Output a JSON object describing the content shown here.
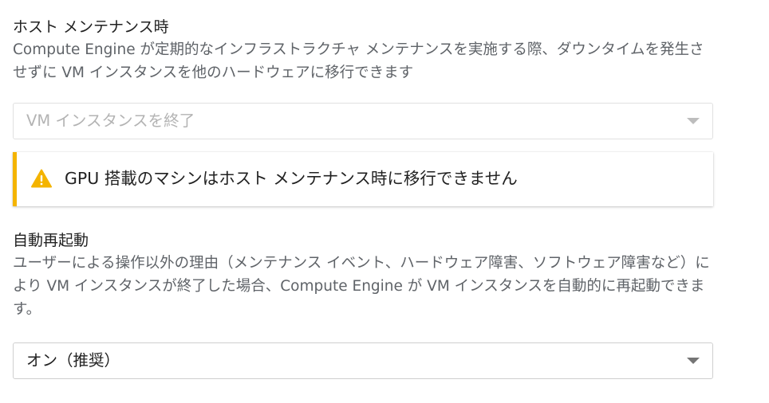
{
  "host_maintenance": {
    "title": "ホスト メンテナンス時",
    "description": "Compute Engine が定期的なインフラストラクチャ メンテナンスを実施する際、ダウンタイムを発生させずに VM インスタンスを他のハードウェアに移行できます",
    "select_value": "VM インスタンスを終了",
    "select_state": "disabled"
  },
  "warning": {
    "icon": "warning-icon",
    "color": "#f4b400",
    "text": "GPU 搭載のマシンはホスト メンテナンス時に移行できません"
  },
  "auto_restart": {
    "title": "自動再起動",
    "description": "ユーザーによる操作以外の理由（メンテナンス イベント、ハードウェア障害、ソフトウェア障害など）により VM インスタンスが終了した場合、Compute Engine が VM インスタンスを自動的に再起動できます。",
    "select_value": "オン（推奨）"
  }
}
